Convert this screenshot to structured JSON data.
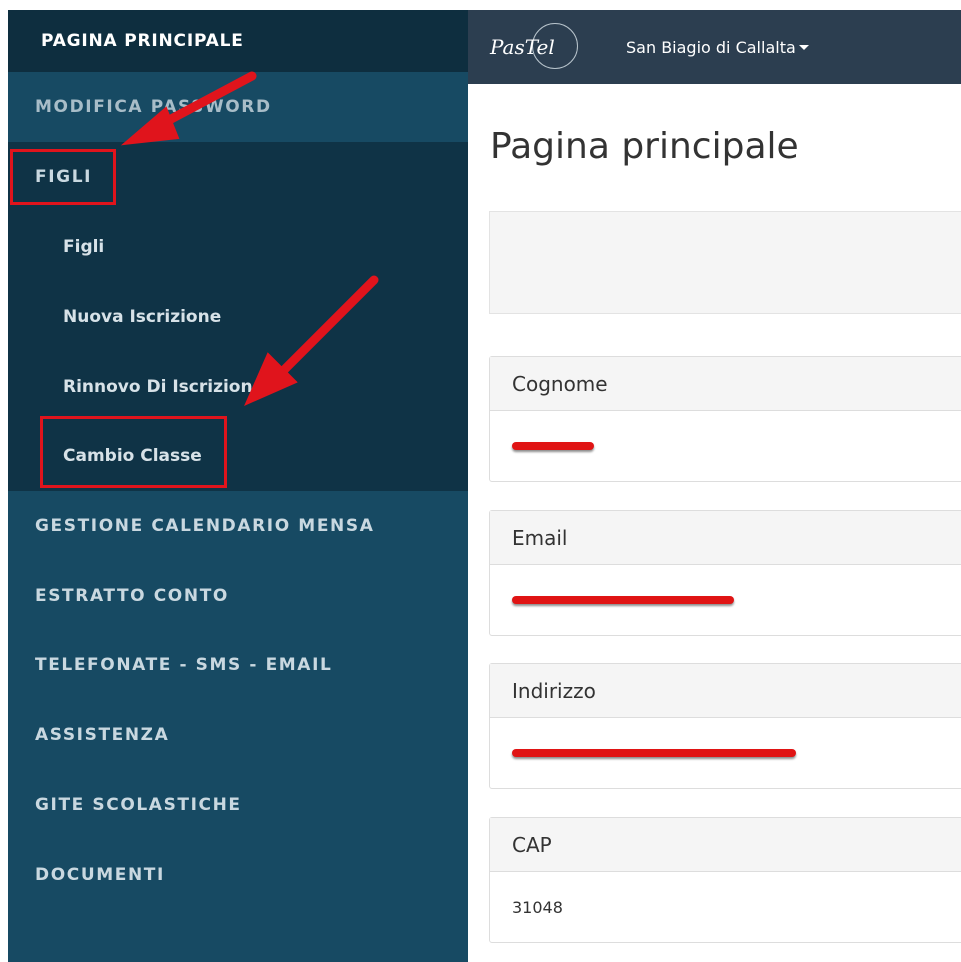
{
  "sidebar": {
    "top_label": "PAGINA PRINCIPALE",
    "items": [
      {
        "label": "MODIFICA PASSWORD"
      },
      {
        "label": "FIGLI"
      },
      {
        "label": "GESTIONE CALENDARIO MENSA"
      },
      {
        "label": "ESTRATTO CONTO"
      },
      {
        "label": "TELEFONATE - SMS - EMAIL"
      },
      {
        "label": "ASSISTENZA"
      },
      {
        "label": "GITE SCOLASTICHE"
      },
      {
        "label": "DOCUMENTI"
      }
    ],
    "figli_sub": [
      {
        "label": "Figli"
      },
      {
        "label": "Nuova Iscrizione"
      },
      {
        "label": "Rinnovo Di Iscrizione"
      },
      {
        "label": "Cambio Classe"
      }
    ]
  },
  "topbar": {
    "logo_text": "PasTel",
    "town": "San Biagio di Callalta"
  },
  "main": {
    "title": "Pagina principale",
    "fields": [
      {
        "label": "Cognome",
        "value": ""
      },
      {
        "label": "Email",
        "value": ""
      },
      {
        "label": "Indirizzo",
        "value": ""
      },
      {
        "label": "CAP",
        "value": "31048"
      }
    ]
  },
  "colors": {
    "sidebar": "#174a63",
    "sidebar_dark": "#0f3346",
    "topbar": "#2c3e50",
    "annotation_red": "#e0141c"
  }
}
